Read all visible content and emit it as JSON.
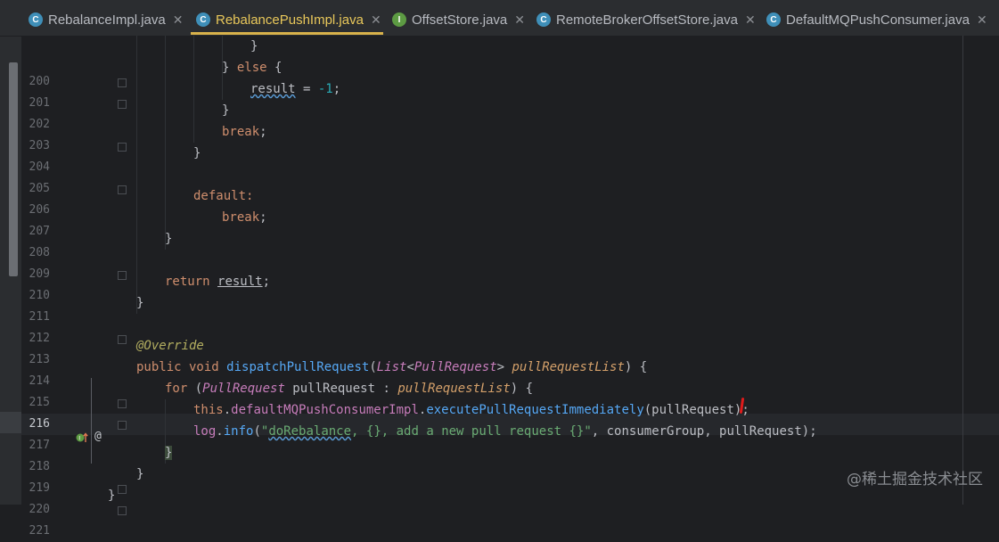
{
  "tabs": [
    {
      "label": "RebalanceImpl.java",
      "icon": "class-icon",
      "active": false
    },
    {
      "label": "RebalancePushImpl.java",
      "icon": "class-icon",
      "active": true
    },
    {
      "label": "OffsetStore.java",
      "icon": "interface-icon",
      "active": false
    },
    {
      "label": "RemoteBrokerOffsetStore.java",
      "icon": "class-icon",
      "active": false
    },
    {
      "label": "DefaultMQPushConsumer.java",
      "icon": "class-icon",
      "active": false
    }
  ],
  "line_numbers": [
    "200",
    "201",
    "202",
    "203",
    "204",
    "205",
    "206",
    "207",
    "208",
    "209",
    "210",
    "211",
    "212",
    "213",
    "214",
    "215",
    "216",
    "217",
    "218",
    "219",
    "220",
    "221"
  ],
  "current_line": "216",
  "code": {
    "l200": "}",
    "l201_a": "} ",
    "l201_b": "else",
    "l201_c": " {",
    "l202_a": "result",
    "l202_b": " = ",
    "l202_c": "-1",
    "l202_d": ";",
    "l203": "}",
    "l204_a": "break",
    "l204_b": ";",
    "l205": "}",
    "l207": "default:",
    "l208_a": "break",
    "l208_b": ";",
    "l209": "}",
    "l211_a": "return",
    "l211_b": " ",
    "l211_c": "result",
    "l211_d": ";",
    "l212": "}",
    "l214": "@Override",
    "l215_a": "public void",
    "l215_b": " ",
    "l215_c": "dispatchPullRequest",
    "l215_d": "(",
    "l215_e": "List",
    "l215_f": "<",
    "l215_g": "PullRequest",
    "l215_h": "> ",
    "l215_i": "pullRequestList",
    "l215_j": ") {",
    "l216_a": "for",
    "l216_b": " (",
    "l216_c": "PullRequest",
    "l216_d": " pullRequest : ",
    "l216_e": "pullRequestList",
    "l216_f": ") {",
    "l217_a": "this",
    "l217_b": ".",
    "l217_c": "defaultMQPushConsumerImpl",
    "l217_d": ".",
    "l217_e": "executePullRequestImmediately",
    "l217_f": "(pullRequest);",
    "l218_a": "log",
    "l218_b": ".",
    "l218_c": "info",
    "l218_d": "(",
    "l218_e": "\"",
    "l218_f": "doRebalance",
    "l218_g": ", {}, add a new pull request {}\"",
    "l218_h": ", consumerGroup, pullRequest);",
    "l219": "}",
    "l220": "}",
    "l221": "}"
  },
  "gutter": {
    "override_marker": "@"
  },
  "watermark": "@稀土掘金技术社区",
  "colors": {
    "background": "#1e1f22",
    "keyword": "#cf8e6d",
    "string": "#6aab73",
    "number": "#2aacb8",
    "method": "#56a8f5",
    "annotation": "#b3ae60",
    "active_tab": "#e8c75a"
  }
}
